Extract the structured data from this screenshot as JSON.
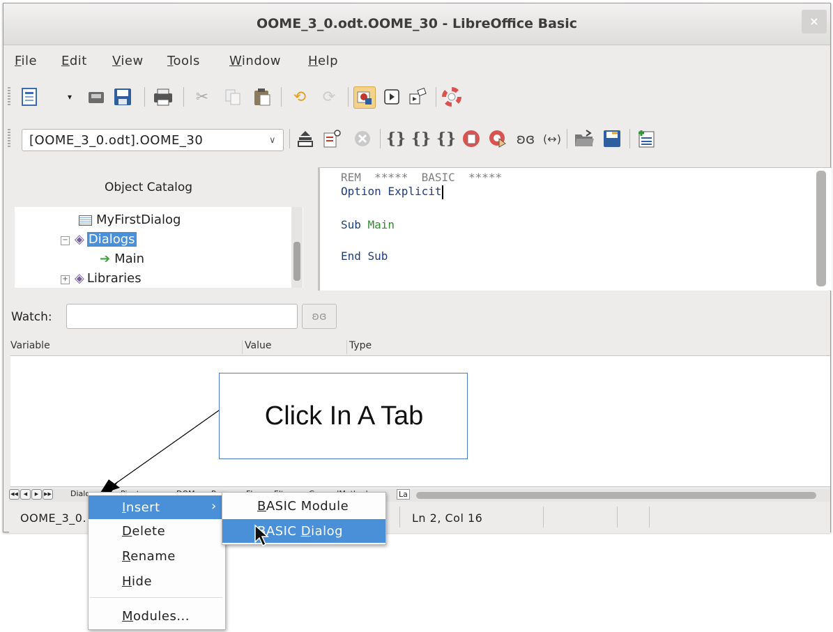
{
  "window": {
    "title": "OOME_3_0.odt.OOME_30 - LibreOffice Basic",
    "close_glyph": "×"
  },
  "menubar": {
    "items": [
      {
        "first": "F",
        "rest": "ile"
      },
      {
        "first": "E",
        "rest": "dit"
      },
      {
        "first": "V",
        "rest": "iew"
      },
      {
        "first": "T",
        "rest": "ools"
      },
      {
        "first": "W",
        "rest": "indow"
      },
      {
        "first": "H",
        "rest": "elp"
      }
    ]
  },
  "toolbar2": {
    "library_combo": "[OOME_3_0.odt].OOME_30"
  },
  "catalog": {
    "title": "Object Catalog",
    "rows": [
      "MyFirstDialog",
      "Dialogs",
      "Main",
      "Libraries"
    ]
  },
  "editor": {
    "lines": [
      "REM  *****  BASIC  *****",
      "Option Explicit",
      "Sub ",
      "Main",
      "End Sub"
    ]
  },
  "watch": {
    "label": "Watch:",
    "value": ""
  },
  "variables": {
    "columns": [
      "Variable",
      "Value",
      "Type"
    ]
  },
  "tabs": {
    "labels": [
      "Dialog",
      "Pivot",
      "DOM",
      "Para",
      "Fl",
      "Elte",
      "GeneralMethods",
      "La"
    ]
  },
  "statusbar": {
    "doc": "OOME_3_0.",
    "position": "Ln 2, Col 16"
  },
  "callout": {
    "text": "Click In A Tab"
  },
  "context_menu": {
    "items": [
      {
        "first": "I",
        "rest": "nsert",
        "submenu_arrow": "›"
      },
      {
        "first": "D",
        "rest": "elete"
      },
      {
        "first": "R",
        "rest": "ename"
      },
      {
        "first": "H",
        "rest": "ide"
      },
      {
        "first": "M",
        "rest": "odules..."
      }
    ]
  },
  "submenu": {
    "items": [
      {
        "first": "B",
        "rest": "ASIC Module"
      },
      {
        "pre": "BASIC ",
        "first": "D",
        "rest": "ialog"
      }
    ]
  },
  "colors": {
    "highlight": "#4a90d9",
    "keyword": "#1f3d7a",
    "identifier": "#2e8b2e",
    "comment": "#808080"
  }
}
